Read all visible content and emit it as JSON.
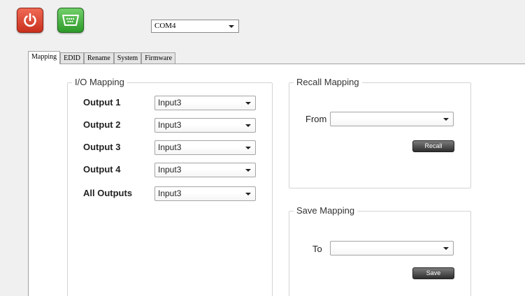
{
  "toolbar": {
    "port": "COM4",
    "colors": {
      "power": "#d9432c",
      "serial": "#3fae3a"
    }
  },
  "tabs": [
    "Mapping",
    "EDID",
    "Rename",
    "System",
    "Firmware"
  ],
  "io_mapping": {
    "title": "I/O Mapping",
    "rows": [
      {
        "label": "Output 1",
        "value": "Input3"
      },
      {
        "label": "Output 2",
        "value": "Input3"
      },
      {
        "label": "Output 3",
        "value": "Input3"
      },
      {
        "label": "Output 4",
        "value": "Input3"
      },
      {
        "label": "All Outputs",
        "value": "Input3"
      }
    ]
  },
  "recall_mapping": {
    "title": "Recall Mapping",
    "from_label": "From",
    "from_value": "",
    "button": "Recall"
  },
  "save_mapping": {
    "title": "Save Mapping",
    "to_label": "To",
    "to_value": "",
    "button": "Save"
  }
}
